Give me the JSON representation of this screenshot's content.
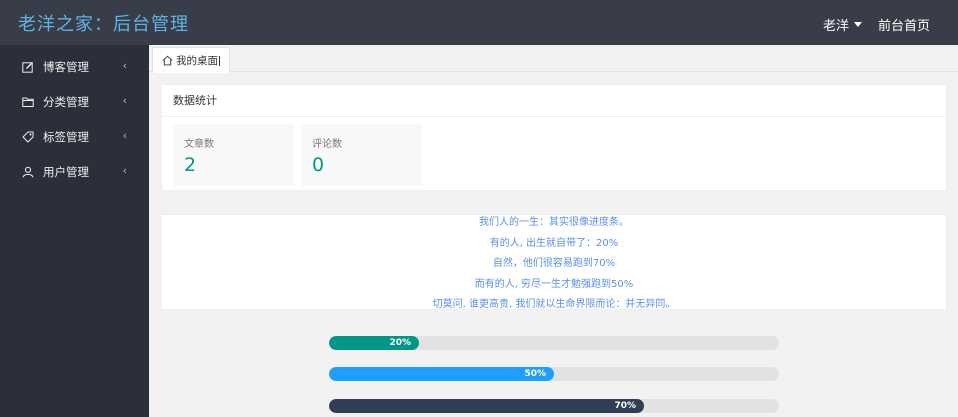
{
  "header": {
    "title": "老洋之家：后台管理",
    "user_name": "老洋",
    "home_link": "前台首页"
  },
  "sidebar": {
    "items": [
      {
        "label": "博客管理",
        "icon": "edit-icon"
      },
      {
        "label": "分类管理",
        "icon": "folder-icon"
      },
      {
        "label": "标签管理",
        "icon": "tag-icon"
      },
      {
        "label": "用户管理",
        "icon": "user-icon"
      }
    ],
    "arrow_glyph": "‹"
  },
  "tabs": [
    {
      "label": "我的桌面",
      "icon": "home-icon"
    }
  ],
  "stats": {
    "title": "数据统计",
    "items": [
      {
        "label": "文章数",
        "value": "2"
      },
      {
        "label": "评论数",
        "value": "0"
      }
    ]
  },
  "quote": {
    "lines": [
      "我们人的一生：其实很像进度条。",
      "有的人, 出生就自带了：20%",
      "自然，他们很容易跑到70%",
      "而有的人, 穷尽一生才勉强跑到50%",
      "切莫问, 谁更高贵, 我们就以生命界限而论：并无异同。"
    ]
  },
  "progress": [
    {
      "label": "20%",
      "value": 20,
      "color": "#009688"
    },
    {
      "label": "50%",
      "value": 50,
      "color": "#1e9fff"
    },
    {
      "label": "70%",
      "value": 70,
      "color": "#2f4056"
    }
  ],
  "colors": {
    "topbar": "#393d49",
    "sidebar": "#2b2f3a",
    "logo": "#5fb4e6",
    "stat_value": "#009688",
    "quote_text": "#5a8fe8"
  }
}
